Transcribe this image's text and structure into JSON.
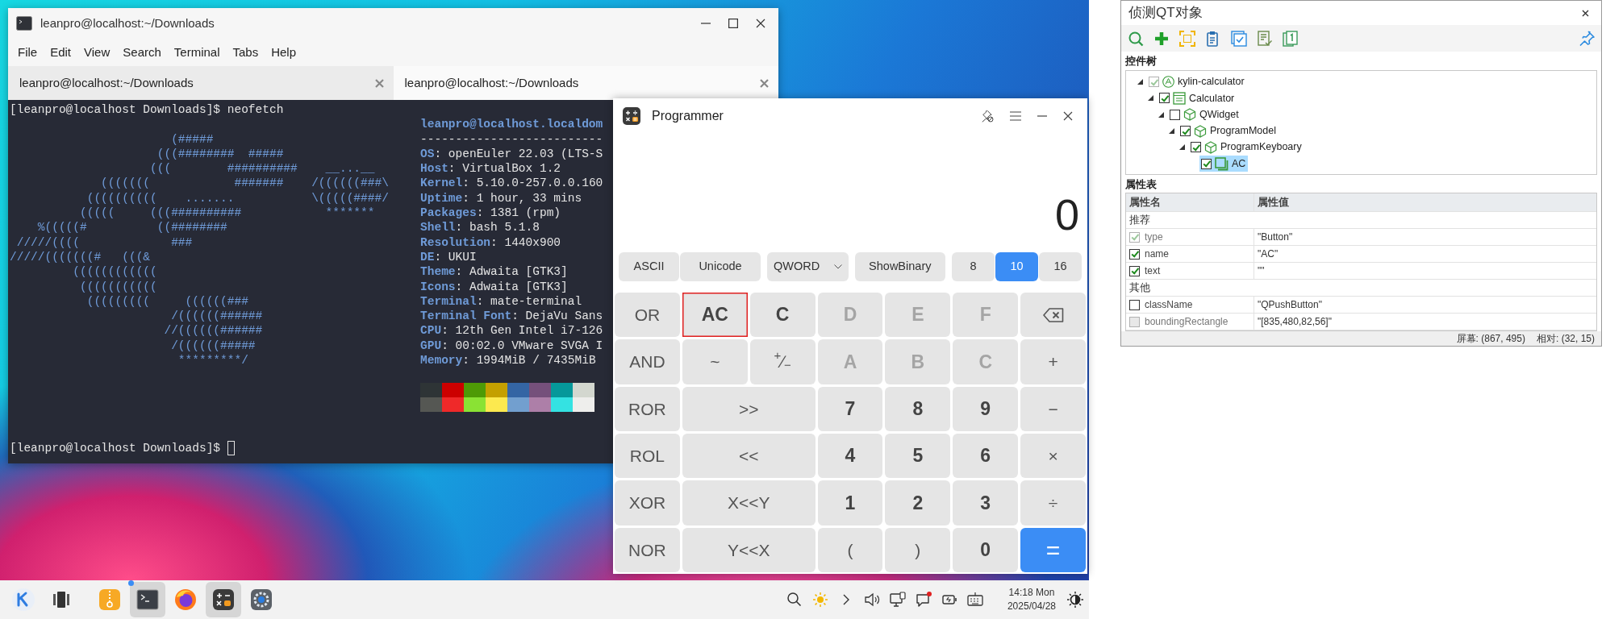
{
  "terminal": {
    "title": "leanpro@localhost:~/Downloads",
    "menu": [
      "File",
      "Edit",
      "View",
      "Search",
      "Terminal",
      "Tabs",
      "Help"
    ],
    "tabs": [
      {
        "label": "leanpro@localhost:~/Downloads",
        "selected": false
      },
      {
        "label": "leanpro@localhost:~/Downloads",
        "selected": true
      }
    ],
    "command": "[leanpro@localhost Downloads]$ neofetch",
    "art": [
      "                       (#####",
      "                     (((########  #####",
      "                    (((        ##########    __...__",
      "             (((((((            #######    /((((((###\\",
      "           ((((((((((    .......           \\(((((####/",
      "          (((((     (((##########            *******",
      "    %(((((#          ((########",
      " /////((((             ###",
      "/////(((((((#   (((&",
      "         ((((((((((((",
      "          (((((((((((",
      "           (((((((((     ((((((###",
      "                       /((((((######",
      "                      //((((((######",
      "                       /((((((#####",
      "                        *********/"
    ],
    "header": "leanpro@localhost.localdom",
    "separator": "--------------------------",
    "info": [
      {
        "label": "OS",
        "value": ": openEuler 22.03 (LTS-S"
      },
      {
        "label": "Host",
        "value": ": VirtualBox 1.2"
      },
      {
        "label": "Kernel",
        "value": ": 5.10.0-257.0.0.160"
      },
      {
        "label": "Uptime",
        "value": ": 1 hour, 33 mins"
      },
      {
        "label": "Packages",
        "value": ": 1381 (rpm)"
      },
      {
        "label": "Shell",
        "value": ": bash 5.1.8"
      },
      {
        "label": "Resolution",
        "value": ": 1440x900"
      },
      {
        "label": "DE",
        "value": ": UKUI"
      },
      {
        "label": "Theme",
        "value": ": Adwaita [GTK3]"
      },
      {
        "label": "Icons",
        "value": ": Adwaita [GTK3]"
      },
      {
        "label": "Terminal",
        "value": ": mate-terminal"
      },
      {
        "label": "Terminal Font",
        "value": ": DejaVu Sans"
      },
      {
        "label": "CPU",
        "value": ": 12th Gen Intel i7-126"
      },
      {
        "label": "GPU",
        "value": ": 00:02.0 VMware SVGA I"
      },
      {
        "label": "Memory",
        "value": ": 1994MiB / 7435MiB"
      }
    ],
    "palette": [
      {
        "color": "#2e3436"
      },
      {
        "color": "#cc0000"
      },
      {
        "color": "#4e9a06"
      },
      {
        "color": "#c4a000"
      },
      {
        "color": "#3465a4"
      },
      {
        "color": "#75507b"
      },
      {
        "color": "#06989a"
      },
      {
        "color": "#d3d7cf"
      },
      {
        "color": "#555753"
      },
      {
        "color": "#ef2929"
      },
      {
        "color": "#8ae234"
      },
      {
        "color": "#fce94f"
      },
      {
        "color": "#729fcf"
      },
      {
        "color": "#ad7fa8"
      },
      {
        "color": "#34e2e2"
      },
      {
        "color": "#eeeeec"
      }
    ],
    "prompt": "[leanpro@localhost Downloads]$"
  },
  "calculator": {
    "title": "Programmer",
    "display": "0",
    "modes": [
      "ASCII",
      "Unicode"
    ],
    "word_size": "QWORD",
    "binary_button": "ShowBinary",
    "bases": [
      {
        "label": "8",
        "selected": false
      },
      {
        "label": "10",
        "selected": true
      },
      {
        "label": "16",
        "selected": false
      }
    ],
    "keys": [
      {
        "label": "OR",
        "kind": "op",
        "disabled": false,
        "highlighted": false
      },
      {
        "label": "AC",
        "kind": "digit",
        "disabled": false,
        "highlighted": true
      },
      {
        "label": "C",
        "kind": "digit",
        "disabled": false,
        "highlighted": false
      },
      {
        "label": "D",
        "kind": "digit",
        "disabled": true,
        "highlighted": false
      },
      {
        "label": "E",
        "kind": "digit",
        "disabled": true,
        "highlighted": false
      },
      {
        "label": "F",
        "kind": "digit",
        "disabled": true,
        "highlighted": false
      },
      {
        "kind": "backspace",
        "disabled": false,
        "highlighted": false
      },
      {
        "label": "AND",
        "kind": "op",
        "disabled": false,
        "highlighted": false
      },
      {
        "label": "~",
        "kind": "op",
        "disabled": false,
        "highlighted": false
      },
      {
        "label": "$^{+}$∕$_{−}$",
        "kind": "op",
        "disabled": false,
        "highlighted": false
      },
      {
        "label": "A",
        "kind": "digit",
        "disabled": true,
        "highlighted": false
      },
      {
        "label": "B",
        "kind": "digit",
        "disabled": true,
        "highlighted": false
      },
      {
        "label": "C",
        "kind": "digit",
        "disabled": true,
        "highlighted": false
      },
      {
        "label": "+",
        "kind": "op",
        "disabled": false,
        "highlighted": false
      },
      {
        "label": "ROR",
        "kind": "op",
        "disabled": false,
        "highlighted": false
      },
      {
        "label": ">>",
        "kind": "wide",
        "disabled": false,
        "highlighted": false
      },
      {
        "label": "7",
        "kind": "digit",
        "disabled": false,
        "highlighted": false
      },
      {
        "label": "8",
        "kind": "digit",
        "disabled": false,
        "highlighted": false
      },
      {
        "label": "9",
        "kind": "digit",
        "disabled": false,
        "highlighted": false
      },
      {
        "label": "−",
        "kind": "op",
        "disabled": false,
        "highlighted": false
      },
      {
        "label": "ROL",
        "kind": "op",
        "disabled": false,
        "highlighted": false
      },
      {
        "label": "<<",
        "kind": "wide",
        "disabled": false,
        "highlighted": false
      },
      {
        "label": "4",
        "kind": "digit",
        "disabled": false,
        "highlighted": false
      },
      {
        "label": "5",
        "kind": "digit",
        "disabled": false,
        "highlighted": false
      },
      {
        "label": "6",
        "kind": "digit",
        "disabled": false,
        "highlighted": false
      },
      {
        "label": "×",
        "kind": "op",
        "disabled": false,
        "highlighted": false
      },
      {
        "label": "XOR",
        "kind": "op",
        "disabled": false,
        "highlighted": false
      },
      {
        "label": "X<<Y",
        "kind": "wide",
        "disabled": false,
        "highlighted": false
      },
      {
        "label": "1",
        "kind": "digit",
        "disabled": false,
        "highlighted": false
      },
      {
        "label": "2",
        "kind": "digit",
        "disabled": false,
        "highlighted": false
      },
      {
        "label": "3",
        "kind": "digit",
        "disabled": false,
        "highlighted": false
      },
      {
        "label": "÷",
        "kind": "op",
        "disabled": false,
        "highlighted": false
      },
      {
        "label": "NOR",
        "kind": "op",
        "disabled": false,
        "highlighted": false
      },
      {
        "label": "Y<<X",
        "kind": "wide",
        "disabled": false,
        "highlighted": false
      },
      {
        "label": "(",
        "kind": "op",
        "disabled": false,
        "highlighted": false
      },
      {
        "label": ")",
        "kind": "op",
        "disabled": false,
        "highlighted": false
      },
      {
        "label": "0",
        "kind": "digit",
        "disabled": false,
        "highlighted": false
      },
      {
        "label": "=",
        "kind": "equals",
        "disabled": false,
        "highlighted": false
      }
    ]
  },
  "inspector": {
    "title": "侦测QT对象",
    "tree_label": "控件树",
    "tree": [
      {
        "label": "kylin-calculator",
        "kind": "application",
        "checked": true,
        "disabled": true,
        "expanded": true,
        "selected": false,
        "children": [
          {
            "label": "Calculator",
            "kind": "window",
            "checked": true,
            "disabled": false,
            "expanded": true,
            "selected": false,
            "children": [
              {
                "label": "QWidget",
                "kind": "widget",
                "checked": false,
                "disabled": false,
                "expanded": true,
                "selected": false,
                "children": [
                  {
                    "label": "ProgramModel",
                    "kind": "widget",
                    "checked": true,
                    "disabled": false,
                    "expanded": true,
                    "selected": false,
                    "children": [
                      {
                        "label": "ProgramKeyboary",
                        "kind": "widget",
                        "checked": true,
                        "disabled": false,
                        "expanded": true,
                        "selected": false,
                        "children": [
                          {
                            "label": "AC",
                            "kind": "button",
                            "checked": true,
                            "disabled": false,
                            "selected": true
                          }
                        ]
                      }
                    ]
                  }
                ]
              }
            ]
          }
        ]
      }
    ],
    "properties_label": "属性表",
    "columns": [
      "属性名",
      "属性值"
    ],
    "groups": [
      {
        "label": "推荐",
        "rows": [
          {
            "name": "type",
            "value": "\"Button\"",
            "checked": true,
            "disabled": true
          },
          {
            "name": "name",
            "value": "\"AC\"",
            "checked": true,
            "disabled": false
          },
          {
            "name": "text",
            "value": "\"\"",
            "checked": true,
            "disabled": false
          }
        ]
      },
      {
        "label": "其他",
        "rows": [
          {
            "name": "className",
            "value": "\"QPushButton\"",
            "checked": false,
            "disabled": false
          },
          {
            "name": "boundingRectangle",
            "value": "\"[835,480,82,56]\"",
            "checked": false,
            "disabled": true
          }
        ]
      }
    ],
    "status": [
      "屏幕: (867, 495)",
      "相对: (32, 15)"
    ]
  },
  "taskbar": {
    "apps": [
      {
        "kind": "start",
        "active": false,
        "notified": false
      },
      {
        "kind": "multitask",
        "active": false,
        "notified": false
      },
      {
        "kind": "archive",
        "active": false,
        "notified": false
      },
      {
        "kind": "terminal",
        "active": true,
        "notified": true
      },
      {
        "kind": "browser",
        "active": false,
        "notified": false
      },
      {
        "kind": "calculator",
        "active": true,
        "notified": false
      },
      {
        "kind": "settings",
        "active": false,
        "notified": false
      }
    ],
    "tray": [
      {
        "kind": "search",
        "alert": false
      },
      {
        "kind": "brightness",
        "alert": false
      },
      {
        "kind": "chevron",
        "alert": false
      },
      {
        "kind": "volume",
        "alert": false
      },
      {
        "kind": "display",
        "alert": false
      },
      {
        "kind": "message",
        "alert": true
      },
      {
        "kind": "battery",
        "alert": false
      },
      {
        "kind": "keyboard",
        "alert": false
      }
    ],
    "time": "14:18 Mon",
    "date": "2025/04/28"
  }
}
